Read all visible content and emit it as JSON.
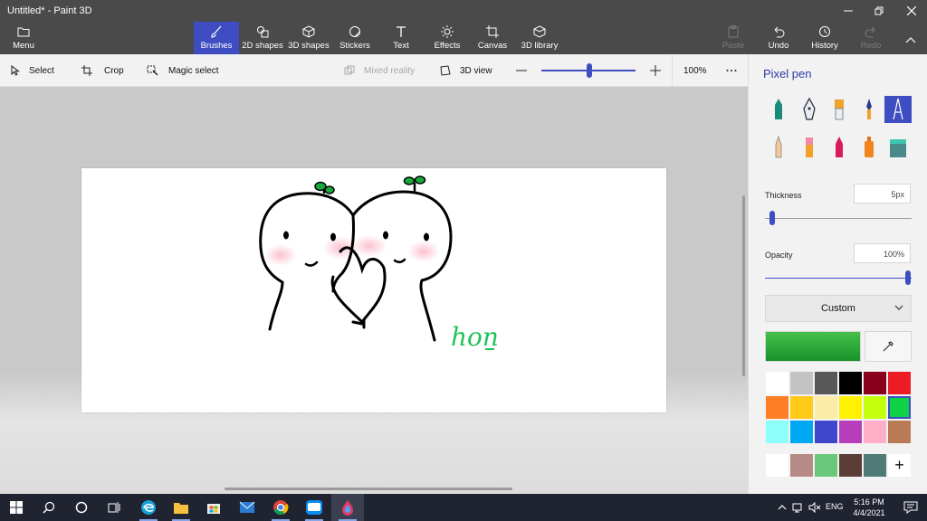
{
  "window": {
    "title": "Untitled* - Paint 3D"
  },
  "ribbon": {
    "menu": "Menu",
    "tabs": [
      {
        "label": "Brushes",
        "icon": "brush-icon",
        "active": true
      },
      {
        "label": "2D shapes",
        "icon": "2d-shapes-icon"
      },
      {
        "label": "3D shapes",
        "icon": "3d-shapes-icon"
      },
      {
        "label": "Stickers",
        "icon": "stickers-icon"
      },
      {
        "label": "Text",
        "icon": "text-icon"
      },
      {
        "label": "Effects",
        "icon": "effects-icon"
      },
      {
        "label": "Canvas",
        "icon": "canvas-icon"
      },
      {
        "label": "3D library",
        "icon": "3d-library-icon"
      }
    ],
    "paste": "Paste",
    "undo": "Undo",
    "history": "History",
    "redo": "Redo"
  },
  "toolbar": {
    "select": "Select",
    "crop": "Crop",
    "magic_select": "Magic select",
    "mixed_reality": "Mixed reality",
    "view_3d": "3D view",
    "zoom": "100%",
    "zoom_level": 1.0
  },
  "panel": {
    "title": "Pixel pen",
    "thickness_label": "Thickness",
    "thickness_value": "5px",
    "opacity_label": "Opacity",
    "opacity_value": "100%",
    "color_mode": "Custom",
    "current_color": "#1f9a2f",
    "palette": [
      "#ffffff",
      "#c3c3c3",
      "#585858",
      "#000000",
      "#88001b",
      "#ec1c24",
      "#ff7f27",
      "#ffca18",
      "#fdeca6",
      "#fff200",
      "#c4ff0e",
      "#0ed145",
      "#8cfffb",
      "#00a8f3",
      "#3f48cc",
      "#b83dba",
      "#ffaec8",
      "#b97a56"
    ],
    "selected_swatch": 11,
    "custom_colors": [
      "#ffffff",
      "#b88a86",
      "#6ac87a",
      "#5a3e36",
      "#4f7a76"
    ],
    "add_color": "+"
  },
  "canvas_text": "hon",
  "taskbar": {
    "lang": "ENG",
    "time": "5:16 PM",
    "date": "4/4/2021"
  }
}
